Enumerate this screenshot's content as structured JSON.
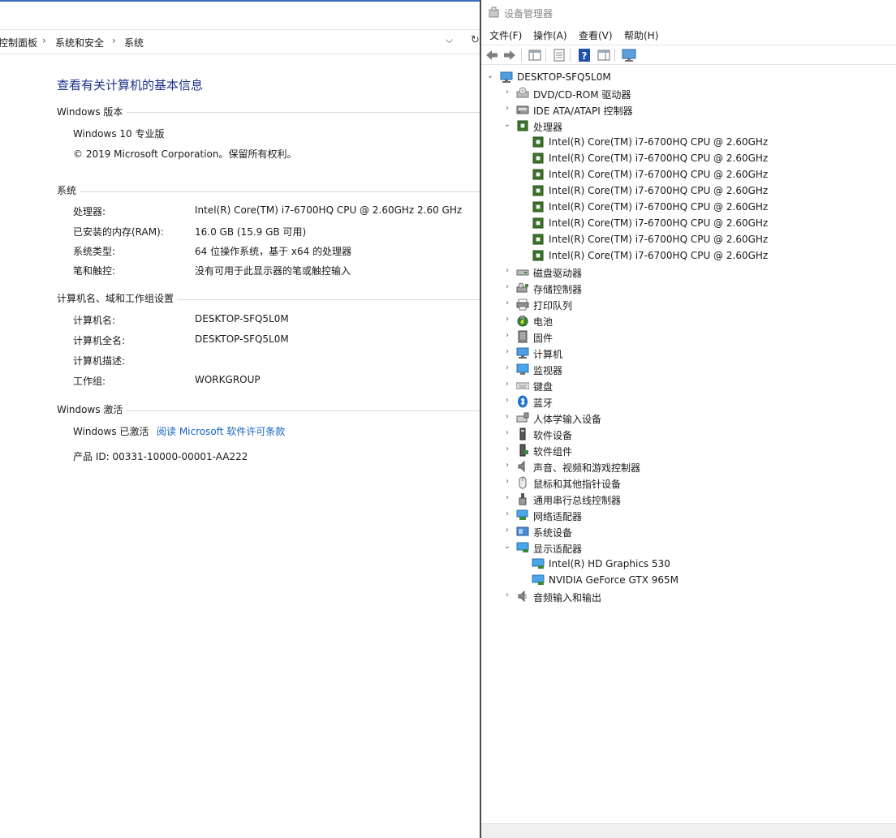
{
  "system": {
    "breadcrumb": [
      "控制面板",
      "系统和安全",
      "系统"
    ],
    "page_title": "查看有关计算机的基本信息",
    "sections": {
      "edition": {
        "heading": "Windows 版本",
        "name": "Windows 10 专业版",
        "copyright": "© 2019 Microsoft Corporation。保留所有权利。"
      },
      "system": {
        "heading": "系统",
        "rows": [
          {
            "label": "处理器:",
            "value": "Intel(R) Core(TM) i7-6700HQ CPU @ 2.60GHz   2.60 GHz"
          },
          {
            "label": "已安装的内存(RAM):",
            "value": "16.0 GB (15.9 GB 可用)"
          },
          {
            "label": "系统类型:",
            "value": "64 位操作系统，基于 x64 的处理器"
          },
          {
            "label": "笔和触控:",
            "value": "没有可用于此显示器的笔或触控输入"
          }
        ]
      },
      "computer": {
        "heading": "计算机名、域和工作组设置",
        "rows": [
          {
            "label": "计算机名:",
            "value": "DESKTOP-SFQ5L0M"
          },
          {
            "label": "计算机全名:",
            "value": "DESKTOP-SFQ5L0M"
          },
          {
            "label": "计算机描述:",
            "value": ""
          },
          {
            "label": "工作组:",
            "value": "WORKGROUP"
          }
        ]
      },
      "activation": {
        "heading": "Windows 激活",
        "status": "Windows 已激活",
        "license_link": "阅读 Microsoft 软件许可条款",
        "product_id": "产品 ID: 00331-10000-00001-AA222"
      }
    }
  },
  "devmgr": {
    "title": "设备管理器",
    "menu": [
      "文件(F)",
      "操作(A)",
      "查看(V)",
      "帮助(H)"
    ],
    "root": "DESKTOP-SFQ5L0M",
    "tree": [
      {
        "label": "DVD/CD-ROM 驱动器",
        "icon": "dvd-drive-icon",
        "expanded": false
      },
      {
        "label": "IDE ATA/ATAPI 控制器",
        "icon": "ide-controller-icon",
        "expanded": false
      },
      {
        "label": "处理器",
        "icon": "processor-icon",
        "expanded": true,
        "children": [
          {
            "label": "Intel(R) Core(TM) i7-6700HQ CPU @ 2.60GHz",
            "icon": "processor-icon"
          },
          {
            "label": "Intel(R) Core(TM) i7-6700HQ CPU @ 2.60GHz",
            "icon": "processor-icon"
          },
          {
            "label": "Intel(R) Core(TM) i7-6700HQ CPU @ 2.60GHz",
            "icon": "processor-icon"
          },
          {
            "label": "Intel(R) Core(TM) i7-6700HQ CPU @ 2.60GHz",
            "icon": "processor-icon"
          },
          {
            "label": "Intel(R) Core(TM) i7-6700HQ CPU @ 2.60GHz",
            "icon": "processor-icon"
          },
          {
            "label": "Intel(R) Core(TM) i7-6700HQ CPU @ 2.60GHz",
            "icon": "processor-icon"
          },
          {
            "label": "Intel(R) Core(TM) i7-6700HQ CPU @ 2.60GHz",
            "icon": "processor-icon"
          },
          {
            "label": "Intel(R) Core(TM) i7-6700HQ CPU @ 2.60GHz",
            "icon": "processor-icon"
          }
        ]
      },
      {
        "label": "磁盘驱动器",
        "icon": "disk-drive-icon",
        "expanded": false
      },
      {
        "label": "存储控制器",
        "icon": "storage-controller-icon",
        "expanded": false
      },
      {
        "label": "打印队列",
        "icon": "printer-icon",
        "expanded": false
      },
      {
        "label": "电池",
        "icon": "battery-icon",
        "expanded": false
      },
      {
        "label": "固件",
        "icon": "firmware-icon",
        "expanded": false
      },
      {
        "label": "计算机",
        "icon": "computer-icon",
        "expanded": false
      },
      {
        "label": "监视器",
        "icon": "monitor-icon",
        "expanded": false
      },
      {
        "label": "键盘",
        "icon": "keyboard-icon",
        "expanded": false
      },
      {
        "label": "蓝牙",
        "icon": "bluetooth-icon",
        "expanded": false
      },
      {
        "label": "人体学输入设备",
        "icon": "hid-icon",
        "expanded": false
      },
      {
        "label": "软件设备",
        "icon": "software-device-icon",
        "expanded": false
      },
      {
        "label": "软件组件",
        "icon": "software-component-icon",
        "expanded": false
      },
      {
        "label": "声音、视频和游戏控制器",
        "icon": "speaker-icon",
        "expanded": false
      },
      {
        "label": "鼠标和其他指针设备",
        "icon": "mouse-icon",
        "expanded": false
      },
      {
        "label": "通用串行总线控制器",
        "icon": "usb-icon",
        "expanded": false
      },
      {
        "label": "网络适配器",
        "icon": "network-adapter-icon",
        "expanded": false
      },
      {
        "label": "系统设备",
        "icon": "system-device-icon",
        "expanded": false
      },
      {
        "label": "显示适配器",
        "icon": "display-adapter-icon",
        "expanded": true,
        "children": [
          {
            "label": "Intel(R) HD Graphics 530",
            "icon": "display-adapter-icon"
          },
          {
            "label": "NVIDIA GeForce GTX 965M",
            "icon": "display-adapter-icon"
          }
        ]
      },
      {
        "label": "音频输入和输出",
        "icon": "audio-io-icon",
        "expanded": false
      }
    ]
  },
  "colors": {
    "title_blue": "#1e3287",
    "link_blue": "#1565c0",
    "processor_green": "#3f7a2a"
  }
}
